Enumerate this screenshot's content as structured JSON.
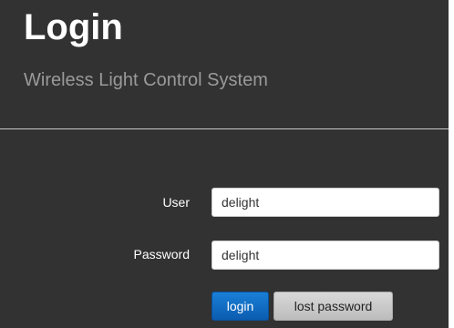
{
  "header": {
    "title": "Login",
    "subtitle": "Wireless Light Control System"
  },
  "form": {
    "user_label": "User",
    "user_value": "delight",
    "password_label": "Password",
    "password_value": "delight",
    "login_label": "login",
    "lost_password_label": "lost password"
  },
  "colors": {
    "panel_background": "#323232",
    "primary_button": "#1a7fd6",
    "secondary_button": "#d0d0d0"
  }
}
